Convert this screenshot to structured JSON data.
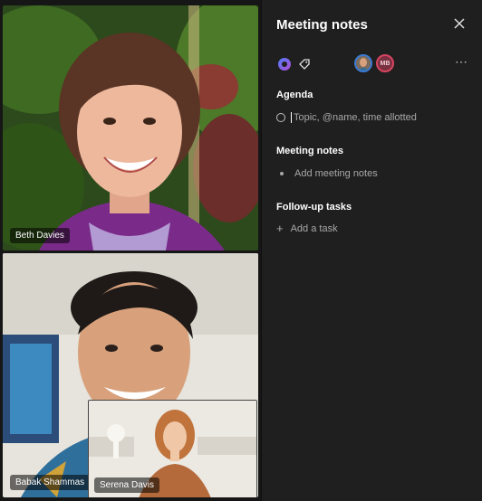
{
  "videos": {
    "top": {
      "name": "Beth Davies"
    },
    "bottom": {
      "name": "Babak Shammas"
    },
    "pip": {
      "name": "Serena Davis"
    }
  },
  "panel": {
    "title": "Meeting notes",
    "close_icon": "close-icon",
    "toolbar": {
      "loop_icon": "loop-icon",
      "tag_icon": "tag-icon",
      "participant_2_initials": "MB",
      "more_icon": "more-horizontal-icon"
    },
    "sections": {
      "agenda": {
        "title": "Agenda",
        "placeholder": "Topic, @name, time allotted"
      },
      "notes": {
        "title": "Meeting notes",
        "placeholder": "Add meeting notes"
      },
      "tasks": {
        "title": "Follow-up tasks",
        "placeholder": "Add a task"
      }
    }
  },
  "colors": {
    "panel_bg": "#1f1f1f",
    "text_primary": "#ffffff",
    "text_secondary": "#a8a8a8",
    "avatar_ring_1": "#3a7bd5",
    "avatar_ring_2": "#d64560"
  }
}
